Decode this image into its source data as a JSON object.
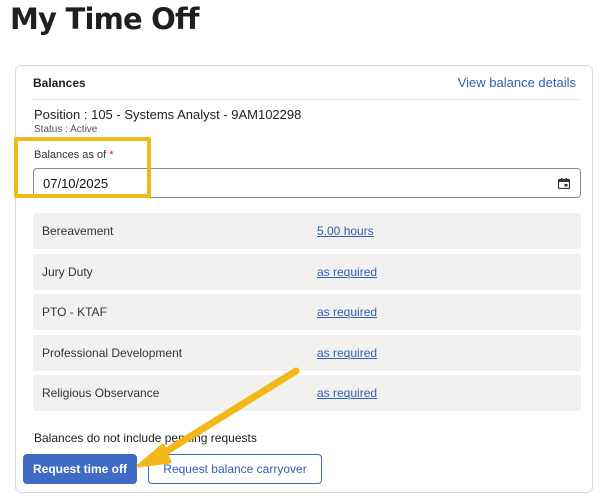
{
  "page": {
    "title": "My Time Off"
  },
  "balances": {
    "title": "Balances",
    "view_details_link": "View balance details",
    "position": "Position : 105 - Systems Analyst - 9AM102298",
    "status": "Status : Active",
    "date_label": "Balances as of",
    "required_marker": "*",
    "date_value": "07/10/2025",
    "items": [
      {
        "name": "Bereavement",
        "value": "5.00 hours"
      },
      {
        "name": "Jury Duty",
        "value": "as required"
      },
      {
        "name": "PTO - KTAF",
        "value": "as required"
      },
      {
        "name": "Professional Development",
        "value": "as required"
      },
      {
        "name": "Religious Observance",
        "value": "as required"
      }
    ],
    "note": "Balances do not include pending requests"
  },
  "actions": {
    "request_time_off": "Request time off",
    "request_carryover": "Request balance carryover"
  },
  "colors": {
    "accent": "#3f6bc4",
    "link": "#2f5fb3",
    "highlight": "#f2b81a",
    "row_background": "#f2f1ef"
  },
  "icons": {
    "date_picker": "calendar-icon"
  }
}
